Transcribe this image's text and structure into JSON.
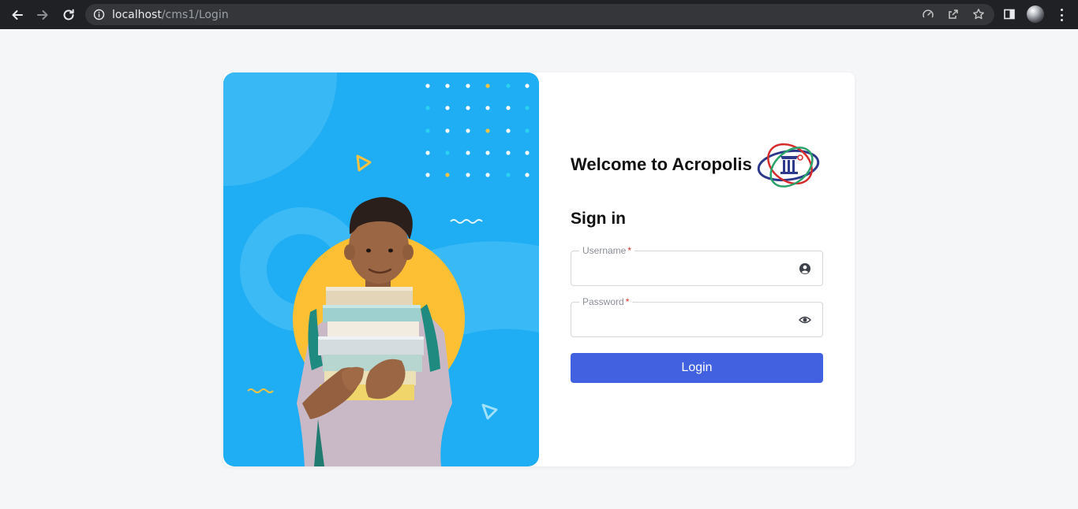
{
  "browser": {
    "url_host": "localhost",
    "url_path": "/cms1/Login",
    "icons": [
      "back-arrow-icon",
      "forward-arrow-icon",
      "reload-icon",
      "info-icon",
      "performance-icon",
      "share-icon",
      "bookmark-star-icon",
      "side-panel-icon",
      "profile-avatar",
      "more-menu-icon"
    ]
  },
  "login": {
    "welcome": "Welcome to Acropolis",
    "signin_heading": "Sign in",
    "username_label": "Username",
    "password_label": "Password",
    "required_mark": "*",
    "username_value": "",
    "password_value": "",
    "login_button": "Login"
  },
  "colors": {
    "hero_background": "#1fadf4",
    "primary_button": "#4161e0",
    "required": "#d32f2f",
    "page_background": "#f5f6f8"
  }
}
